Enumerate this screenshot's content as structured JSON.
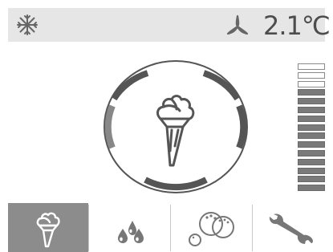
{
  "status": {
    "mode_icon": "snowflake-icon",
    "fan_icon": "fan-icon",
    "temperature": "2.1℃"
  },
  "dial": {
    "icon": "ice-cream-cone-icon"
  },
  "level": {
    "segments_total": 15,
    "segments_filled": 12
  },
  "tabs": [
    {
      "icon": "ice-cream-cone-icon",
      "active": true
    },
    {
      "icon": "water-drops-icon",
      "active": false
    },
    {
      "icon": "bubbles-icon",
      "active": false
    },
    {
      "icon": "wrench-icon",
      "active": false
    }
  ],
  "colors": {
    "status_bg": "#e6e6e6",
    "icon_gray": "#777777",
    "active_tab": "#8c8c8c"
  }
}
